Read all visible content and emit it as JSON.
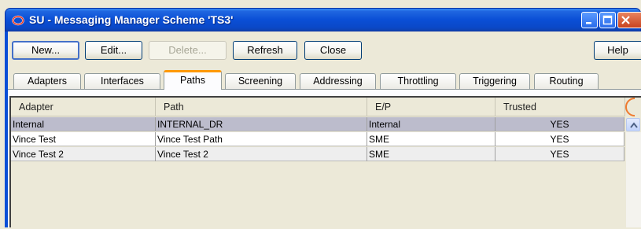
{
  "window": {
    "title": "SU - Messaging Manager Scheme 'TS3'",
    "title_bar_color": "#0a4fd6",
    "app_icon": "oracle-ring-icon"
  },
  "toolbar": {
    "new_label": "New...",
    "edit_label": "Edit...",
    "delete_label": "Delete...",
    "refresh_label": "Refresh",
    "close_label": "Close",
    "help_label": "Help"
  },
  "tabs": [
    {
      "label": "Adapters"
    },
    {
      "label": "Interfaces"
    },
    {
      "label": "Paths",
      "active": true
    },
    {
      "label": "Screening"
    },
    {
      "label": "Addressing"
    },
    {
      "label": "Throttling"
    },
    {
      "label": "Triggering"
    },
    {
      "label": "Routing"
    }
  ],
  "table": {
    "columns": [
      "Adapter",
      "Path",
      "E/P",
      "Trusted"
    ],
    "rows": [
      {
        "adapter": "Internal",
        "path": "INTERNAL_DR",
        "ep": "Internal",
        "trusted": "YES",
        "selected": true
      },
      {
        "adapter": "Vince Test",
        "path": "Vince Test Path",
        "ep": "SME",
        "trusted": "YES"
      },
      {
        "adapter": "Vince Test 2",
        "path": "Vince Test 2",
        "ep": "SME",
        "trusted": "YES"
      }
    ]
  },
  "colors": {
    "selected_row": "#bcbccc",
    "active_tab_accent": "#ff9900"
  }
}
